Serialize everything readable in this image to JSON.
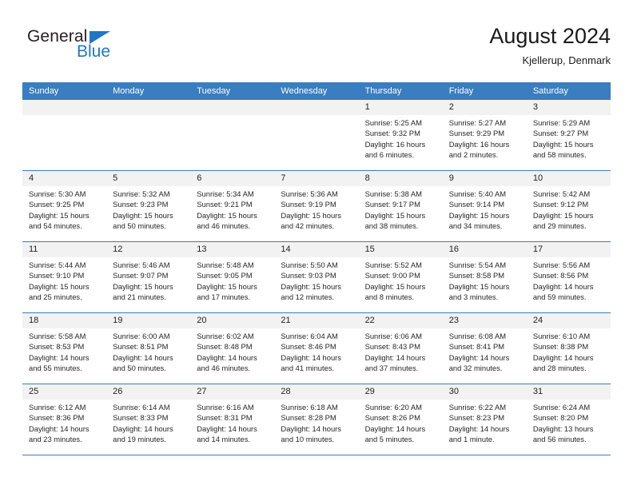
{
  "brand": {
    "name_top": "General",
    "name_bottom": "Blue",
    "accent_color": "#1f77c4"
  },
  "header": {
    "title": "August 2024",
    "subtitle": "Kjellerup, Denmark"
  },
  "theme": {
    "header_row_bg": "#3a7dc0",
    "day_number_bg": "#f2f2f2",
    "grid_line": "#3a7dc0",
    "text": "#262626"
  },
  "labels": {
    "sunrise_prefix": "Sunrise:",
    "sunset_prefix": "Sunset:",
    "daylight_prefix": "Daylight:"
  },
  "weekdays": [
    "Sunday",
    "Monday",
    "Tuesday",
    "Wednesday",
    "Thursday",
    "Friday",
    "Saturday"
  ],
  "weeks": [
    [
      {
        "day": "",
        "empty": true,
        "l1": "",
        "l2": "",
        "l3": "",
        "l4": ""
      },
      {
        "day": "",
        "empty": true,
        "l1": "",
        "l2": "",
        "l3": "",
        "l4": ""
      },
      {
        "day": "",
        "empty": true,
        "l1": "",
        "l2": "",
        "l3": "",
        "l4": ""
      },
      {
        "day": "",
        "empty": true,
        "l1": "",
        "l2": "",
        "l3": "",
        "l4": ""
      },
      {
        "day": "1",
        "l1": "Sunrise: 5:25 AM",
        "l2": "Sunset: 9:32 PM",
        "l3": "Daylight: 16 hours",
        "l4": "and 6 minutes."
      },
      {
        "day": "2",
        "l1": "Sunrise: 5:27 AM",
        "l2": "Sunset: 9:29 PM",
        "l3": "Daylight: 16 hours",
        "l4": "and 2 minutes."
      },
      {
        "day": "3",
        "l1": "Sunrise: 5:29 AM",
        "l2": "Sunset: 9:27 PM",
        "l3": "Daylight: 15 hours",
        "l4": "and 58 minutes."
      }
    ],
    [
      {
        "day": "4",
        "l1": "Sunrise: 5:30 AM",
        "l2": "Sunset: 9:25 PM",
        "l3": "Daylight: 15 hours",
        "l4": "and 54 minutes."
      },
      {
        "day": "5",
        "l1": "Sunrise: 5:32 AM",
        "l2": "Sunset: 9:23 PM",
        "l3": "Daylight: 15 hours",
        "l4": "and 50 minutes."
      },
      {
        "day": "6",
        "l1": "Sunrise: 5:34 AM",
        "l2": "Sunset: 9:21 PM",
        "l3": "Daylight: 15 hours",
        "l4": "and 46 minutes."
      },
      {
        "day": "7",
        "l1": "Sunrise: 5:36 AM",
        "l2": "Sunset: 9:19 PM",
        "l3": "Daylight: 15 hours",
        "l4": "and 42 minutes."
      },
      {
        "day": "8",
        "l1": "Sunrise: 5:38 AM",
        "l2": "Sunset: 9:17 PM",
        "l3": "Daylight: 15 hours",
        "l4": "and 38 minutes."
      },
      {
        "day": "9",
        "l1": "Sunrise: 5:40 AM",
        "l2": "Sunset: 9:14 PM",
        "l3": "Daylight: 15 hours",
        "l4": "and 34 minutes."
      },
      {
        "day": "10",
        "l1": "Sunrise: 5:42 AM",
        "l2": "Sunset: 9:12 PM",
        "l3": "Daylight: 15 hours",
        "l4": "and 29 minutes."
      }
    ],
    [
      {
        "day": "11",
        "l1": "Sunrise: 5:44 AM",
        "l2": "Sunset: 9:10 PM",
        "l3": "Daylight: 15 hours",
        "l4": "and 25 minutes."
      },
      {
        "day": "12",
        "l1": "Sunrise: 5:46 AM",
        "l2": "Sunset: 9:07 PM",
        "l3": "Daylight: 15 hours",
        "l4": "and 21 minutes."
      },
      {
        "day": "13",
        "l1": "Sunrise: 5:48 AM",
        "l2": "Sunset: 9:05 PM",
        "l3": "Daylight: 15 hours",
        "l4": "and 17 minutes."
      },
      {
        "day": "14",
        "l1": "Sunrise: 5:50 AM",
        "l2": "Sunset: 9:03 PM",
        "l3": "Daylight: 15 hours",
        "l4": "and 12 minutes."
      },
      {
        "day": "15",
        "l1": "Sunrise: 5:52 AM",
        "l2": "Sunset: 9:00 PM",
        "l3": "Daylight: 15 hours",
        "l4": "and 8 minutes."
      },
      {
        "day": "16",
        "l1": "Sunrise: 5:54 AM",
        "l2": "Sunset: 8:58 PM",
        "l3": "Daylight: 15 hours",
        "l4": "and 3 minutes."
      },
      {
        "day": "17",
        "l1": "Sunrise: 5:56 AM",
        "l2": "Sunset: 8:56 PM",
        "l3": "Daylight: 14 hours",
        "l4": "and 59 minutes."
      }
    ],
    [
      {
        "day": "18",
        "l1": "Sunrise: 5:58 AM",
        "l2": "Sunset: 8:53 PM",
        "l3": "Daylight: 14 hours",
        "l4": "and 55 minutes."
      },
      {
        "day": "19",
        "l1": "Sunrise: 6:00 AM",
        "l2": "Sunset: 8:51 PM",
        "l3": "Daylight: 14 hours",
        "l4": "and 50 minutes."
      },
      {
        "day": "20",
        "l1": "Sunrise: 6:02 AM",
        "l2": "Sunset: 8:48 PM",
        "l3": "Daylight: 14 hours",
        "l4": "and 46 minutes."
      },
      {
        "day": "21",
        "l1": "Sunrise: 6:04 AM",
        "l2": "Sunset: 8:46 PM",
        "l3": "Daylight: 14 hours",
        "l4": "and 41 minutes."
      },
      {
        "day": "22",
        "l1": "Sunrise: 6:06 AM",
        "l2": "Sunset: 8:43 PM",
        "l3": "Daylight: 14 hours",
        "l4": "and 37 minutes."
      },
      {
        "day": "23",
        "l1": "Sunrise: 6:08 AM",
        "l2": "Sunset: 8:41 PM",
        "l3": "Daylight: 14 hours",
        "l4": "and 32 minutes."
      },
      {
        "day": "24",
        "l1": "Sunrise: 6:10 AM",
        "l2": "Sunset: 8:38 PM",
        "l3": "Daylight: 14 hours",
        "l4": "and 28 minutes."
      }
    ],
    [
      {
        "day": "25",
        "l1": "Sunrise: 6:12 AM",
        "l2": "Sunset: 8:36 PM",
        "l3": "Daylight: 14 hours",
        "l4": "and 23 minutes."
      },
      {
        "day": "26",
        "l1": "Sunrise: 6:14 AM",
        "l2": "Sunset: 8:33 PM",
        "l3": "Daylight: 14 hours",
        "l4": "and 19 minutes."
      },
      {
        "day": "27",
        "l1": "Sunrise: 6:16 AM",
        "l2": "Sunset: 8:31 PM",
        "l3": "Daylight: 14 hours",
        "l4": "and 14 minutes."
      },
      {
        "day": "28",
        "l1": "Sunrise: 6:18 AM",
        "l2": "Sunset: 8:28 PM",
        "l3": "Daylight: 14 hours",
        "l4": "and 10 minutes."
      },
      {
        "day": "29",
        "l1": "Sunrise: 6:20 AM",
        "l2": "Sunset: 8:26 PM",
        "l3": "Daylight: 14 hours",
        "l4": "and 5 minutes."
      },
      {
        "day": "30",
        "l1": "Sunrise: 6:22 AM",
        "l2": "Sunset: 8:23 PM",
        "l3": "Daylight: 14 hours",
        "l4": "and 1 minute."
      },
      {
        "day": "31",
        "l1": "Sunrise: 6:24 AM",
        "l2": "Sunset: 8:20 PM",
        "l3": "Daylight: 13 hours",
        "l4": "and 56 minutes."
      }
    ]
  ]
}
